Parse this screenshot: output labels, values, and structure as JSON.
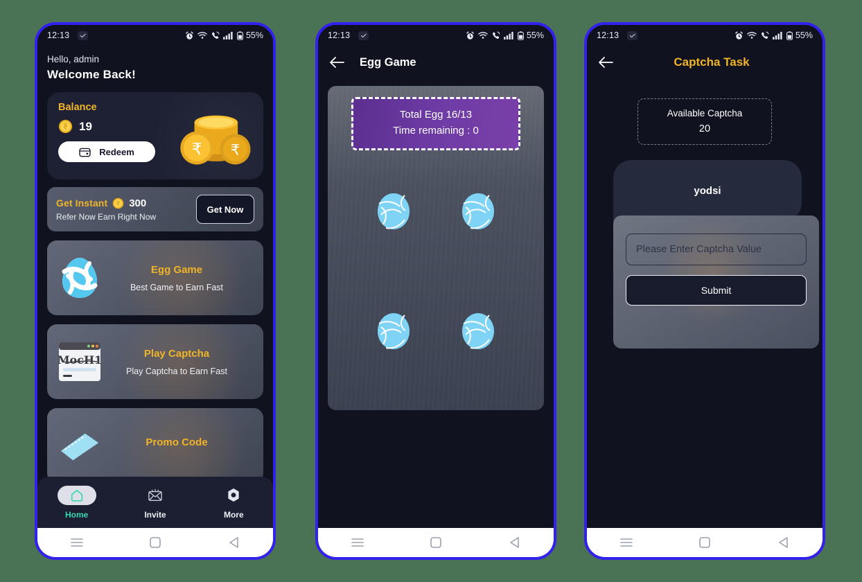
{
  "theme": {
    "page_background": "#4a7254",
    "phone_border": "#3322ee",
    "screen_background": "#10121f",
    "accent_gold": "#f0b429",
    "accent_teal": "#34d9b0",
    "purple_panel": "#6e3ba5",
    "egg_blue": "#7fd4f5"
  },
  "status_bar": {
    "time": "12:13",
    "battery_percent": "55%",
    "icons": [
      "alarm-icon",
      "wifi-icon",
      "call-signal-icon",
      "cellular-bars-icon",
      "battery-icon"
    ],
    "badge_icon": "check-badge-icon"
  },
  "android_nav": {
    "recents_label": "recents-icon",
    "home_label": "home-square-icon",
    "back_label": "back-triangle-icon"
  },
  "phone1": {
    "greeting": "Hello, admin",
    "welcome": "Welcome Back!",
    "balance": {
      "title": "Balance",
      "amount": "19",
      "coin_icon": "coin-icon",
      "redeem_label": "Redeem",
      "redeem_icon": "wallet-icon",
      "art_icon": "coin-stack-illustration"
    },
    "instant": {
      "title": "Get Instant",
      "amount": "300",
      "coin_icon": "coin-icon",
      "subtitle": "Refer Now Earn Right Now",
      "button_label": "Get Now"
    },
    "features": [
      {
        "title": "Egg Game",
        "subtitle": "Best Game to Earn Fast",
        "icon": "egg-swirl-icon"
      },
      {
        "title": "Play Captcha",
        "subtitle": "Play Captcha to Earn Fast",
        "icon": "captcha-browser-icon",
        "captcha_sample_text": "MocH1"
      },
      {
        "title": "Promo Code",
        "subtitle": "",
        "icon": "ticket-icon"
      }
    ],
    "bottom_nav": [
      {
        "label": "Home",
        "icon": "home-icon",
        "active": true
      },
      {
        "label": "Invite",
        "icon": "envelope-icon",
        "active": false
      },
      {
        "label": "More",
        "icon": "hexagon-icon",
        "active": false
      }
    ]
  },
  "phone2": {
    "back_icon": "arrow-left-icon",
    "title": "Egg Game",
    "status": {
      "total_egg": "Total Egg 16/13",
      "time_remaining": "Time remaining : 0"
    },
    "eggs": [
      {
        "icon": "egg-swirl-icon"
      },
      {
        "icon": "egg-swirl-icon"
      },
      {
        "icon": "egg-swirl-icon"
      },
      {
        "icon": "egg-swirl-icon"
      }
    ]
  },
  "phone3": {
    "back_icon": "arrow-left-icon",
    "title": "Captcha Task",
    "available": {
      "label": "Available Captcha",
      "count": "20"
    },
    "captcha_text": "yodsi",
    "input_placeholder": "Please Enter Captcha Value",
    "input_value": "",
    "submit_label": "Submit"
  }
}
